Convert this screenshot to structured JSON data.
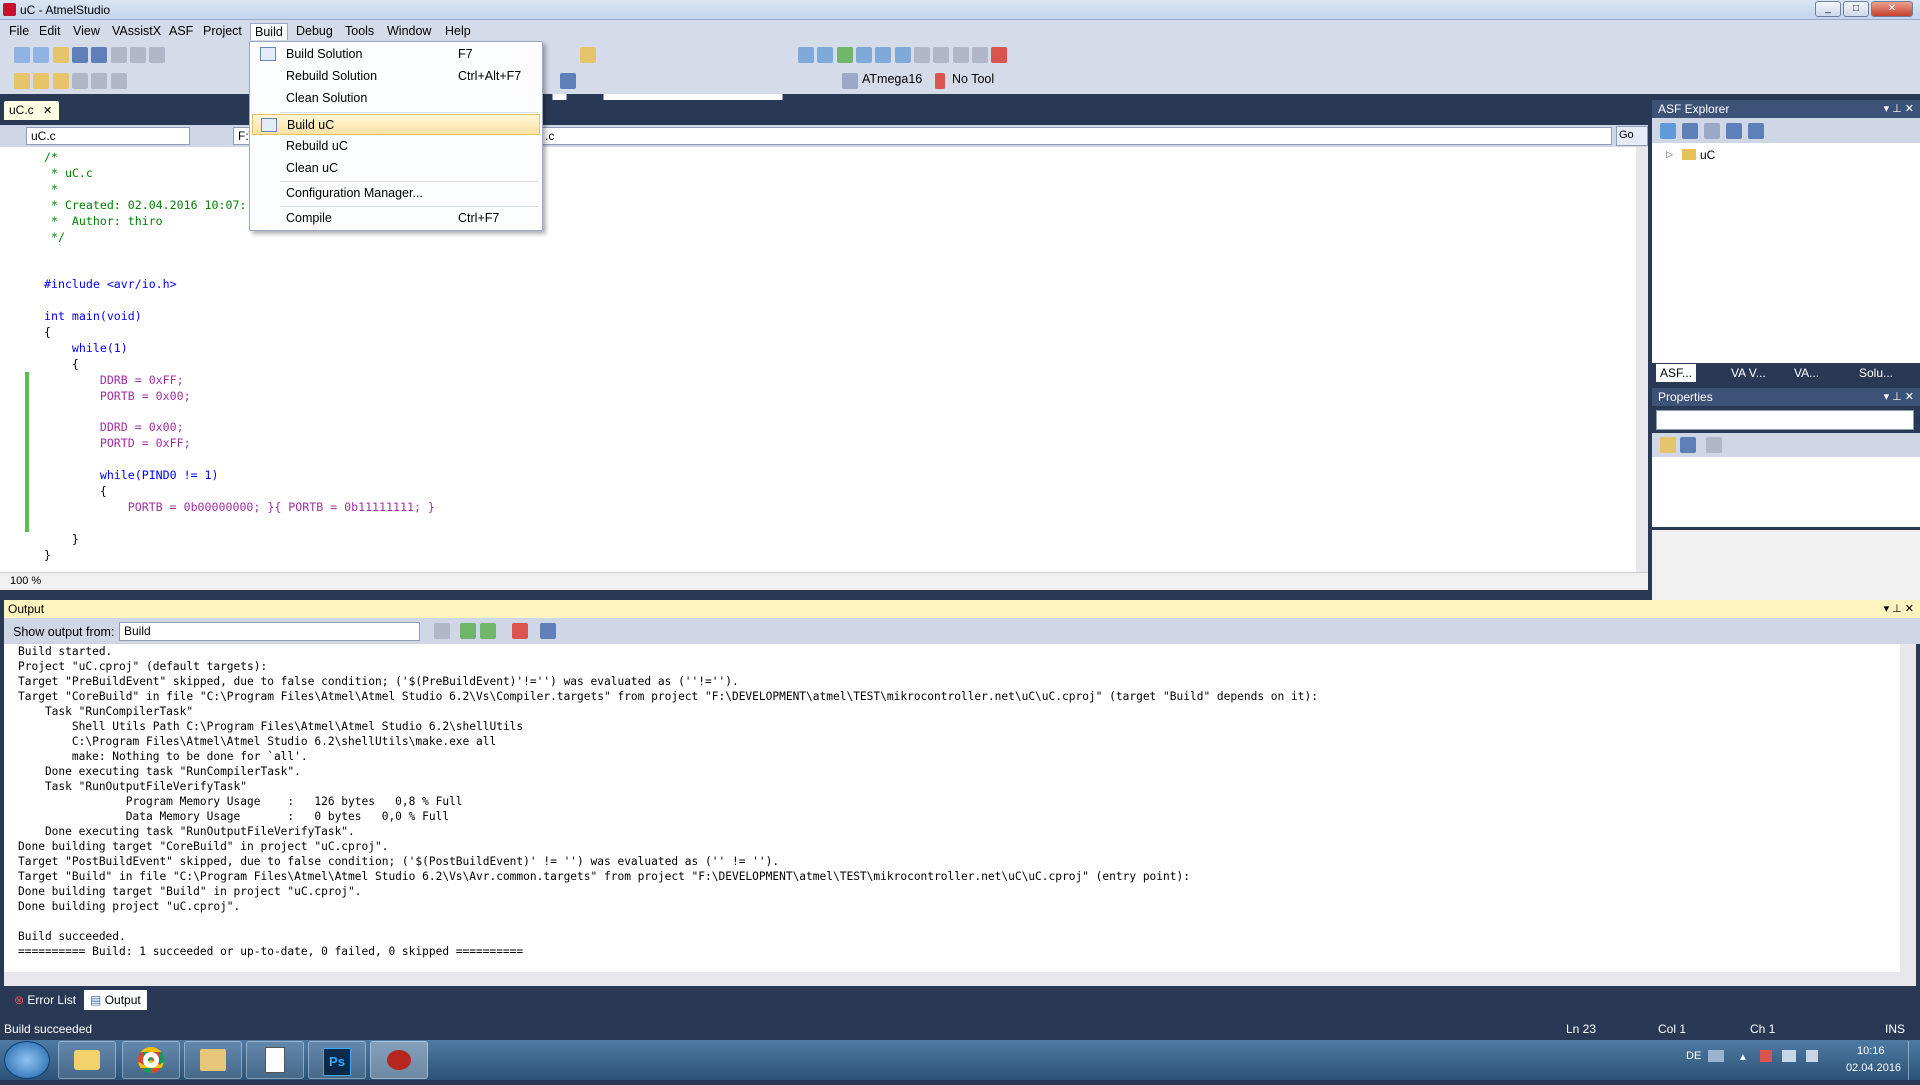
{
  "window": {
    "title": "uC - AtmelStudio",
    "minimize": "_",
    "maximize": "□",
    "close": "✕"
  },
  "menubar": {
    "items": [
      "File",
      "Edit",
      "View",
      "VAssistX",
      "ASF",
      "Project",
      "Build",
      "Debug",
      "Tools",
      "Window",
      "Help"
    ]
  },
  "build_menu": {
    "items": [
      {
        "label": "Build Solution",
        "shortcut": "F7"
      },
      {
        "label": "Rebuild Solution",
        "shortcut": "Ctrl+Alt+F7"
      },
      {
        "label": "Clean Solution",
        "shortcut": ""
      },
      {
        "label": "Build uC",
        "shortcut": ""
      },
      {
        "label": "Rebuild uC",
        "shortcut": ""
      },
      {
        "label": "Clean uC",
        "shortcut": ""
      },
      {
        "label": "Configuration Manager...",
        "shortcut": ""
      },
      {
        "label": "Compile",
        "shortcut": "Ctrl+F7"
      }
    ]
  },
  "toolbar": {
    "device": "ATmega16",
    "tool": "No Tool"
  },
  "document": {
    "tab": "uC.c",
    "nav_left": "uC.c",
    "nav_mid": "F:\\",
    "nav_right": ".c",
    "go": "Go",
    "zoom": "100 %",
    "code_lines": [
      {
        "text": "/*",
        "cls": "green"
      },
      {
        "text": " * uC.c",
        "cls": "green"
      },
      {
        "text": " *",
        "cls": "green"
      },
      {
        "text": " * Created: 02.04.2016 10:07:",
        "cls": "green"
      },
      {
        "text": " *  Author: thiro",
        "cls": "green"
      },
      {
        "text": " */",
        "cls": "green"
      },
      {
        "text": "",
        "cls": "dark"
      },
      {
        "text": "",
        "cls": "dark"
      },
      {
        "text": "#include <avr/io.h>",
        "cls": "blue"
      },
      {
        "text": "",
        "cls": "dark"
      },
      {
        "text": "int main(void)",
        "cls": "blue"
      },
      {
        "text": "{",
        "cls": "dark"
      },
      {
        "text": "    while(1)",
        "cls": "blue"
      },
      {
        "text": "    {",
        "cls": "dark"
      },
      {
        "text": "        DDRB = 0xFF;",
        "cls": "pur"
      },
      {
        "text": "        PORTB = 0x00;",
        "cls": "pur"
      },
      {
        "text": "",
        "cls": "dark"
      },
      {
        "text": "        DDRD = 0x00;",
        "cls": "pur"
      },
      {
        "text": "        PORTD = 0xFF;",
        "cls": "pur"
      },
      {
        "text": "",
        "cls": "dark"
      },
      {
        "text": "        while(PIND0 != 1)",
        "cls": "blue"
      },
      {
        "text": "        {",
        "cls": "dark"
      },
      {
        "text": "            PORTB = 0b00000000; }{ PORTB = 0b11111111; }",
        "cls": "pur"
      },
      {
        "text": "",
        "cls": "dark"
      },
      {
        "text": "    }",
        "cls": "dark"
      },
      {
        "text": "}",
        "cls": "dark"
      }
    ]
  },
  "asf_explorer": {
    "title": "ASF Explorer",
    "tree_item": "uC",
    "tabs": [
      "ASF...",
      "VA V...",
      "VA...",
      "Solu..."
    ]
  },
  "properties": {
    "title": "Properties"
  },
  "output": {
    "title": "Output",
    "show_from_label": "Show output from:",
    "source": "Build",
    "lines": [
      "Build started.",
      "Project \"uC.cproj\" (default targets):",
      "Target \"PreBuildEvent\" skipped, due to false condition; ('$(PreBuildEvent)'!='') was evaluated as (''!='').",
      "Target \"CoreBuild\" in file \"C:\\Program Files\\Atmel\\Atmel Studio 6.2\\Vs\\Compiler.targets\" from project \"F:\\DEVELOPMENT\\atmel\\TEST\\mikrocontroller.net\\uC\\uC.cproj\" (target \"Build\" depends on it):",
      "    Task \"RunCompilerTask\"",
      "        Shell Utils Path C:\\Program Files\\Atmel\\Atmel Studio 6.2\\shellUtils",
      "        C:\\Program Files\\Atmel\\Atmel Studio 6.2\\shellUtils\\make.exe all",
      "        make: Nothing to be done for `all'.",
      "    Done executing task \"RunCompilerTask\".",
      "    Task \"RunOutputFileVerifyTask\"",
      "                Program Memory Usage    :   126 bytes   0,8 % Full",
      "                Data Memory Usage       :   0 bytes   0,0 % Full",
      "    Done executing task \"RunOutputFileVerifyTask\".",
      "Done building target \"CoreBuild\" in project \"uC.cproj\".",
      "Target \"PostBuildEvent\" skipped, due to false condition; ('$(PostBuildEvent)' != '') was evaluated as ('' != '').",
      "Target \"Build\" in file \"C:\\Program Files\\Atmel\\Atmel Studio 6.2\\Vs\\Avr.common.targets\" from project \"F:\\DEVELOPMENT\\atmel\\TEST\\mikrocontroller.net\\uC\\uC.cproj\" (entry point):",
      "Done building target \"Build\" in project \"uC.cproj\".",
      "Done building project \"uC.cproj\".",
      "",
      "Build succeeded.",
      "========== Build: 1 succeeded or up-to-date, 0 failed, 0 skipped =========="
    ]
  },
  "bottom_tabs": [
    "Error List",
    "Output"
  ],
  "statusbar": {
    "message": "Build succeeded",
    "line": "Ln 23",
    "col": "Col 1",
    "ch": "Ch 1",
    "mode": "INS"
  },
  "taskbar": {
    "lang": "DE",
    "time": "10:16",
    "date": "02.04.2016",
    "apps": [
      "explorer-folder-icon",
      "chrome-icon",
      "files-icon",
      "notepad-icon",
      "photoshop-icon",
      "ladybug-icon"
    ],
    "ps_label": "Ps"
  }
}
